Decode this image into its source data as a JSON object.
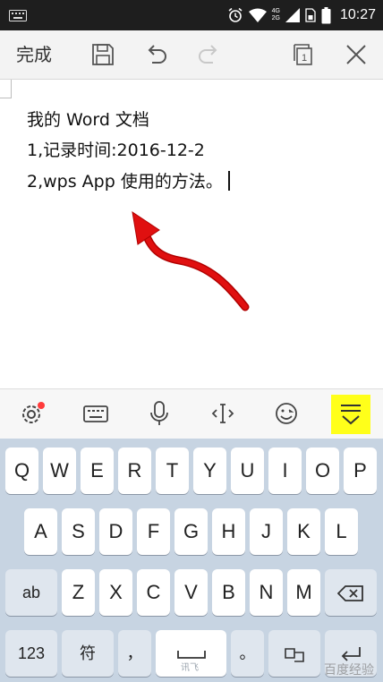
{
  "status_bar": {
    "network": "4G\n2G",
    "time": "10:27"
  },
  "toolbar": {
    "done_label": "完成"
  },
  "document": {
    "lines": [
      "我的 Word 文档",
      "1,记录时间:2016-12-2",
      "2,wps App 使用的方法。"
    ]
  },
  "keyboard": {
    "row1": [
      "Q",
      "W",
      "E",
      "R",
      "T",
      "Y",
      "U",
      "I",
      "O",
      "P"
    ],
    "row2": [
      "A",
      "S",
      "D",
      "F",
      "G",
      "H",
      "J",
      "K",
      "L"
    ],
    "row3": [
      "ab",
      "Z",
      "X",
      "C",
      "V",
      "B",
      "N",
      "M"
    ],
    "row4": [
      "123",
      "符",
      "，",
      "。"
    ],
    "brand": "讯飞"
  },
  "watermark": "百度经验",
  "colors": {
    "highlight": "#ffff1a",
    "arrow": "#e01010",
    "badge": "#ff3b3b",
    "keyboard_bg": "#c7d4e2"
  }
}
